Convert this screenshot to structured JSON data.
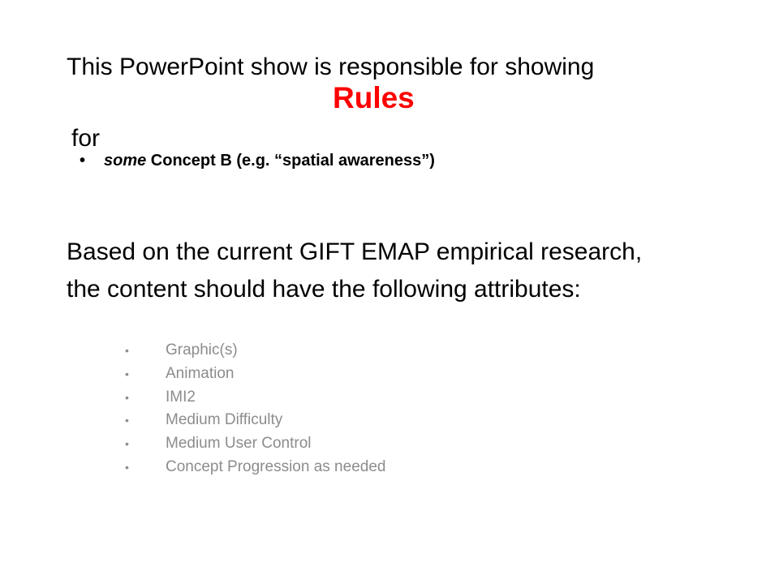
{
  "slide": {
    "intro": "This PowerPoint show is responsible for showing",
    "highlight": "Rules",
    "for_word": "for",
    "concept": {
      "bullet": "•",
      "qualifier": "some",
      "text": " Concept B (e.g. “spatial awareness”)"
    },
    "research_lines": [
      "Based on the current GIFT EMAP empirical research,",
      "the content should have the following attributes:"
    ],
    "attribute_bullet": "•",
    "attributes": [
      "Graphic(s)",
      "Animation",
      "IMI2",
      "Medium Difficulty",
      "Medium User Control",
      "Concept Progression as needed"
    ],
    "colors": {
      "highlight": "#ff0000",
      "attribute_text": "#8c8c8c",
      "body_text": "#000000",
      "background": "#ffffff"
    }
  }
}
